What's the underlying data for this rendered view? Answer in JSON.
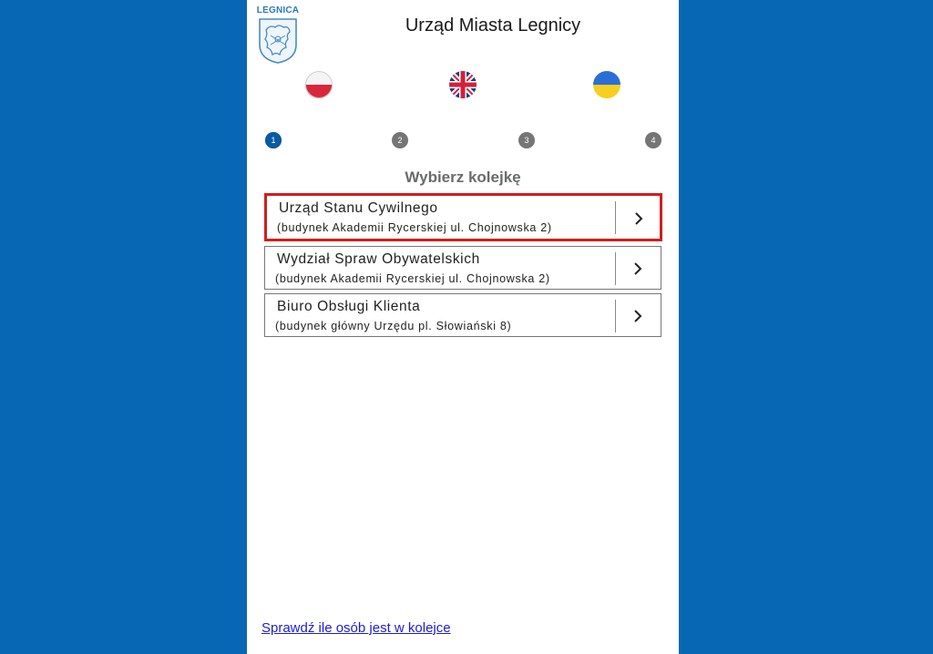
{
  "header": {
    "logo_text": "LEGNICA",
    "title": "Urząd Miasta Legnicy"
  },
  "languages": [
    {
      "code": "pl",
      "icon": "poland-flag-icon"
    },
    {
      "code": "en",
      "icon": "uk-flag-icon"
    },
    {
      "code": "uk",
      "icon": "ukraine-flag-icon"
    }
  ],
  "steps": [
    "1",
    "2",
    "3",
    "4"
  ],
  "active_step": 1,
  "section_title": "Wybierz kolejkę",
  "queues": [
    {
      "name": "Urząd Stanu Cywilnego",
      "location": "(budynek Akademii Rycerskiej ul. Chojnowska 2)"
    },
    {
      "name": "Wydział Spraw Obywatelskich",
      "location": "(budynek Akademii Rycerskiej ul. Chojnowska 2)"
    },
    {
      "name": "Biuro Obsługi Klienta",
      "location": "(budynek główny Urzędu pl. Słowiański 8)"
    }
  ],
  "footer_link": "Sprawdź ile osób jest w kolejce",
  "colors": {
    "background": "#0867b4",
    "accent": "#0a5aa0",
    "highlight_border": "#d21d1d",
    "link": "#1c1cd6"
  }
}
